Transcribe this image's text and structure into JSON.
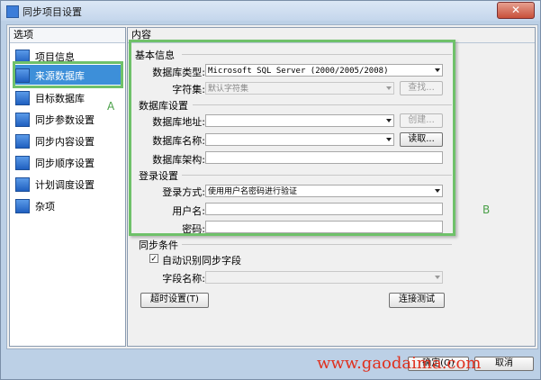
{
  "window": {
    "title": "同步项目设置",
    "close_glyph": "✕"
  },
  "left_panel": {
    "header": "选项",
    "items": [
      {
        "label": "项目信息"
      },
      {
        "label": "来源数据库"
      },
      {
        "label": "目标数据库"
      },
      {
        "label": "同步参数设置"
      },
      {
        "label": "同步内容设置"
      },
      {
        "label": "同步顺序设置"
      },
      {
        "label": "计划调度设置"
      },
      {
        "label": "杂项"
      }
    ],
    "selected_index": 1,
    "marker": "A"
  },
  "right_panel": {
    "header": "内容",
    "marker": "B",
    "basic": {
      "title": "基本信息",
      "db_type_label": "数据库类型:",
      "db_type_value": "Microsoft SQL Server (2000/2005/2008)",
      "charset_label": "字符集:",
      "charset_value": "默认字符集",
      "find_button": "查找..."
    },
    "db_settings": {
      "title": "数据库设置",
      "address_label": "数据库地址:",
      "address_value": "",
      "create_button": "创建...",
      "name_label": "数据库名称:",
      "name_value": "",
      "read_button": "读取...",
      "schema_label": "数据库架构:",
      "schema_value": ""
    },
    "login": {
      "title": "登录设置",
      "mode_label": "登录方式:",
      "mode_value": "使用用户名密码进行验证",
      "user_label": "用户名:",
      "user_value": "",
      "password_label": "密码:",
      "password_value": ""
    },
    "sync_condition": {
      "title": "同步条件",
      "auto_checkbox_label": "自动识别同步字段",
      "auto_checked": true,
      "field_label": "字段名称:",
      "field_value": ""
    },
    "timeout_button": "超时设置(T)",
    "test_button": "连接测试"
  },
  "footer": {
    "ok_button": "确定(O)",
    "cancel_button": "取消"
  },
  "watermark": "www.gaodaima.com",
  "colors": {
    "accent": "#3d8fd9",
    "highlight": "#6fc16a",
    "watermark": "#e0301e"
  }
}
